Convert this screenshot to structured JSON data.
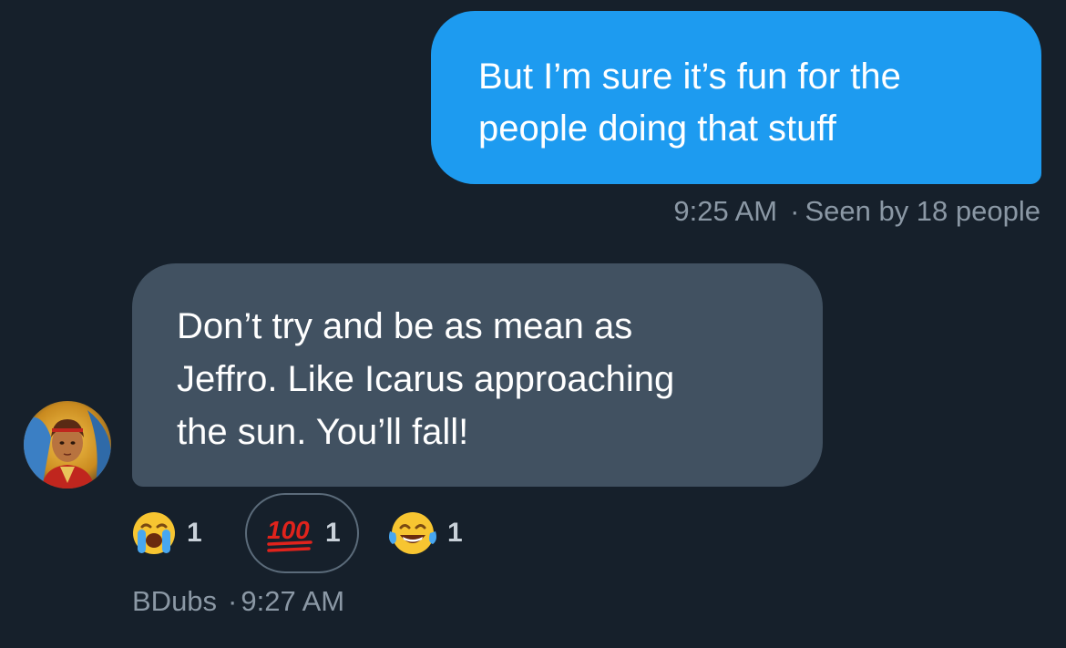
{
  "outgoing": {
    "text": "But I’m sure it’s fun for the\npeople doing that stuff",
    "time": "9:25 AM",
    "separator": "·",
    "seen": "Seen by 18 people"
  },
  "incoming": {
    "text": "Don’t try and be as mean as\nJeffro. Like Icarus approaching\nthe sun. You’ll fall!",
    "sender": "BDubs",
    "separator": "·",
    "time": "9:27 AM"
  },
  "reactions": [
    {
      "icon": "loudly-crying-face-icon",
      "count": "1",
      "selected": false
    },
    {
      "icon": "hundred-points-icon",
      "count": "1",
      "selected": true
    },
    {
      "icon": "face-with-tears-of-joy-icon",
      "count": "1",
      "selected": false
    }
  ],
  "colors": {
    "background": "#16202b",
    "outgoing_bubble": "#1d9bf0",
    "incoming_bubble": "#415161",
    "meta_text": "#8b98a5"
  }
}
